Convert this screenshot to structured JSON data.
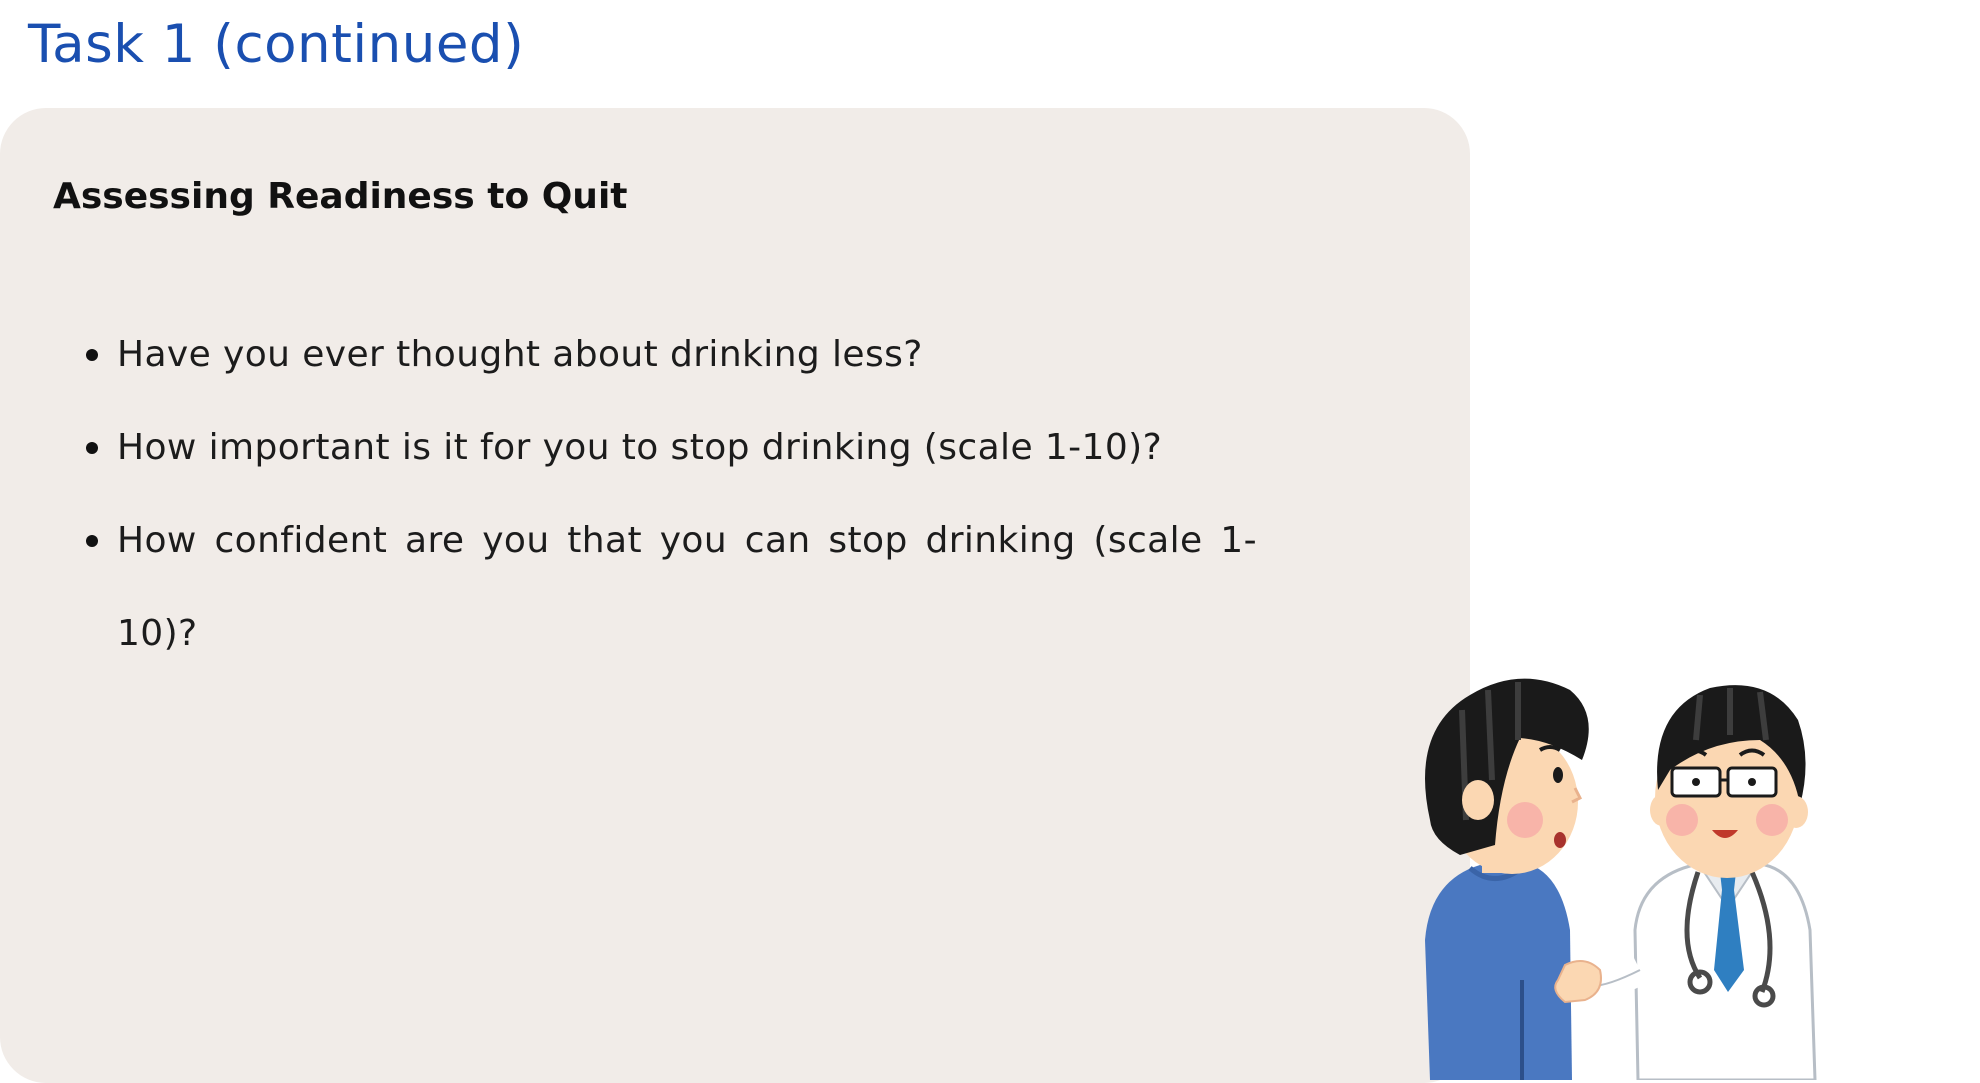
{
  "title": "Task 1 (continued)",
  "card": {
    "heading": "Assessing Readiness to Quit",
    "questions": [
      "Have you ever thought about drinking less?",
      "How important is it for you to stop drinking (scale 1-10)?",
      "How confident are you that you can stop drinking (scale 1-10)?"
    ]
  },
  "colors": {
    "title": "#1a4fb0",
    "card_background": "#f1ece8",
    "patient_shirt": "#4a78c1",
    "doctor_tie": "#2f7fc1",
    "skin": "#fbd7b2",
    "hair": "#1a1a1a"
  },
  "icons": {
    "illustration": "doctor-patient-consultation"
  }
}
